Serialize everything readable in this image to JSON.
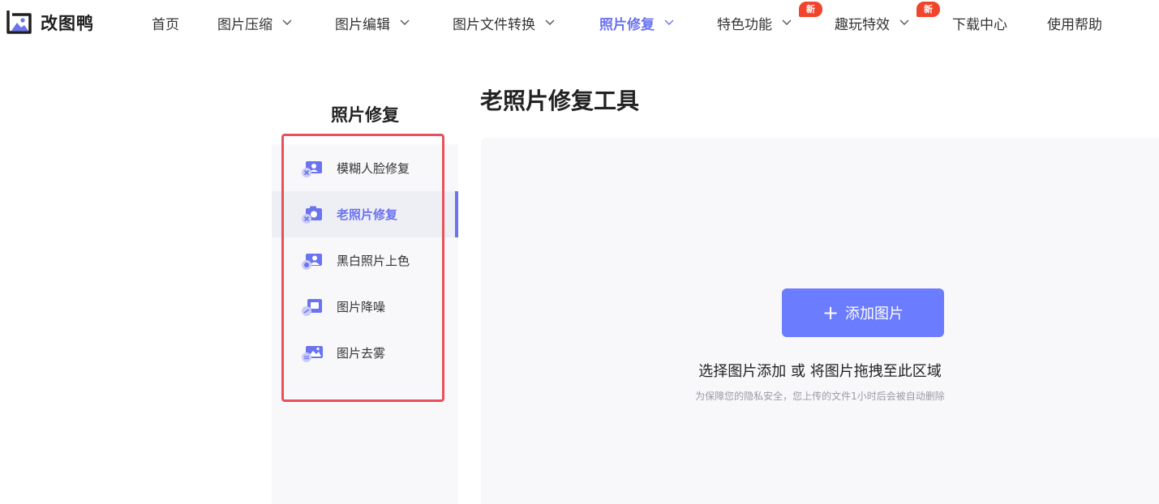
{
  "brand": {
    "name": "改图鸭"
  },
  "nav": {
    "items": [
      {
        "label": "首页",
        "has_dropdown": false
      },
      {
        "label": "图片压缩",
        "has_dropdown": true
      },
      {
        "label": "图片编辑",
        "has_dropdown": true
      },
      {
        "label": "图片文件转换",
        "has_dropdown": true
      },
      {
        "label": "照片修复",
        "has_dropdown": true,
        "active": true
      },
      {
        "label": "特色功能",
        "has_dropdown": true,
        "badge": "新"
      },
      {
        "label": "趣玩特效",
        "has_dropdown": true,
        "badge": "新"
      },
      {
        "label": "下载中心",
        "has_dropdown": false
      },
      {
        "label": "使用帮助",
        "has_dropdown": false
      }
    ]
  },
  "sidebar": {
    "title": "照片修复",
    "items": [
      {
        "label": "模糊人脸修复",
        "icon": "face-restore-icon"
      },
      {
        "label": "老照片修复",
        "icon": "old-photo-icon",
        "active": true
      },
      {
        "label": "黑白照片上色",
        "icon": "colorize-icon"
      },
      {
        "label": "图片降噪",
        "icon": "denoise-icon"
      },
      {
        "label": "图片去雾",
        "icon": "dehaze-icon"
      }
    ]
  },
  "main": {
    "title": "老照片修复工具",
    "upload": {
      "button_label": "添加图片",
      "hint": "选择图片添加 或 将图片拖拽至此区域",
      "privacy_note": "为保障您的隐私安全，您上传的文件1小时后会被自动删除"
    }
  },
  "colors": {
    "accent": "#6b73ef",
    "button": "#6b7cff",
    "badge": "#f0442c",
    "highlight_border": "#e8505b"
  }
}
